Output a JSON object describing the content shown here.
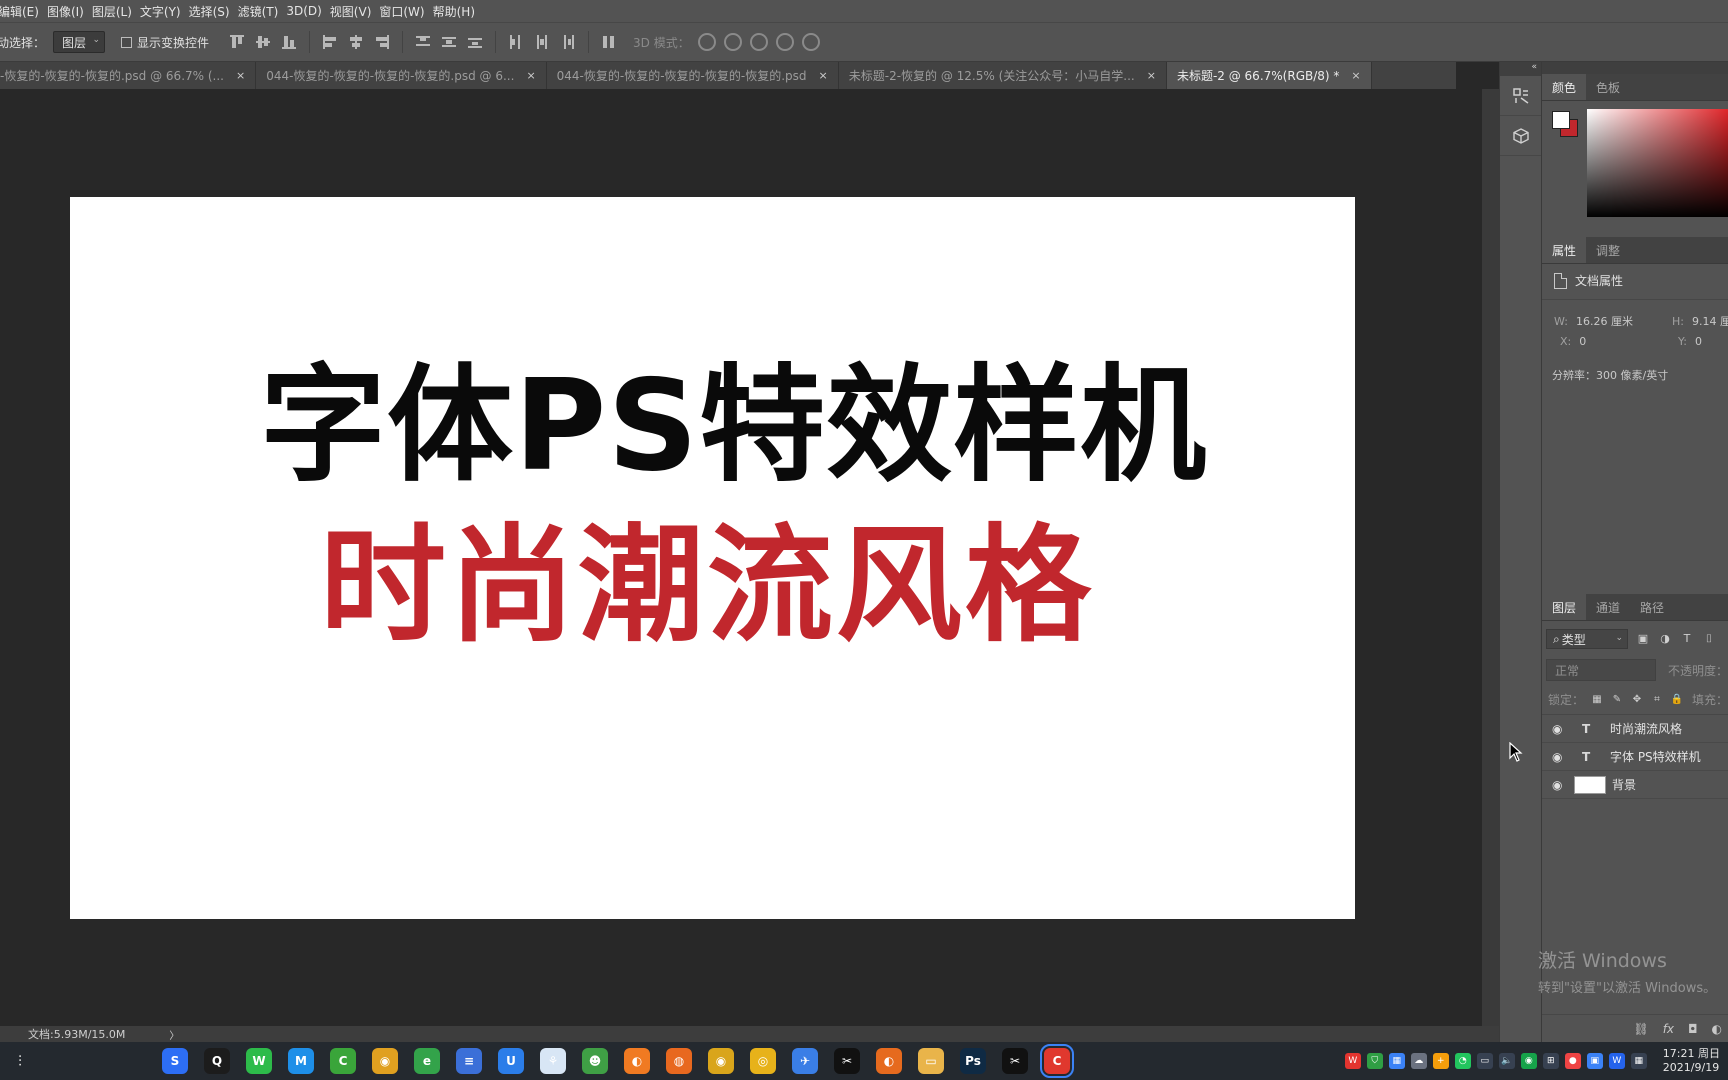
{
  "menu": [
    "编辑(E)",
    "图像(I)",
    "图层(L)",
    "文字(Y)",
    "选择(S)",
    "滤镜(T)",
    "3D(D)",
    "视图(V)",
    "窗口(W)",
    "帮助(H)"
  ],
  "options": {
    "auto_select_label": "动选择：",
    "auto_select_value": "图层",
    "show_transform_label": "显示变换控件",
    "mode_3d_label": "3D 模式："
  },
  "tabs": [
    {
      "label": "-恢复的-恢复的-恢复的.psd @ 66.7% (...",
      "active": false
    },
    {
      "label": "044-恢复的-恢复的-恢复的-恢复的.psd @ 6...",
      "active": false
    },
    {
      "label": "044-恢复的-恢复的-恢复的-恢复的-恢复的.psd",
      "active": false
    },
    {
      "label": "未标题-2-恢复的 @ 12.5% (关注公众号：小马自学...",
      "active": false
    },
    {
      "label": "未标题-2 @ 66.7%(RGB/8) *",
      "active": true
    }
  ],
  "tab_close_glyph": "×",
  "canvas": {
    "line1": "字体PS特效样机",
    "line2": "时尚潮流风格",
    "line1_color": "#0a0a0a",
    "line2_color": "#c1272d"
  },
  "status": {
    "doc_size": "文档:5.93M/15.0M",
    "arrow": "〉"
  },
  "color_panel": {
    "tabs": [
      "颜色",
      "色板"
    ],
    "fg_color": "#ffffff",
    "bg_color": "#c1272d"
  },
  "properties_panel": {
    "tabs": [
      "属性",
      "调整"
    ],
    "header": "文档属性",
    "w_label": "W:",
    "w_value": "16.26 厘米",
    "h_label": "H:",
    "h_value": "9.14 厘",
    "x_label": "X:",
    "x_value": "0",
    "y_label": "Y:",
    "y_value": "0",
    "resolution": "分辨率：300 像素/英寸"
  },
  "layers_panel": {
    "tabs": [
      "图层",
      "通道",
      "路径"
    ],
    "filter_value": "类型",
    "blend_mode": "正常",
    "opacity_label": "不透明度：",
    "lock_label": "锁定：",
    "fill_label": "填充：",
    "layers": [
      {
        "name": "时尚潮流风格",
        "kind": "text",
        "type_glyph": "T"
      },
      {
        "name": "字体 PS特效样机",
        "kind": "text",
        "type_glyph": "T"
      },
      {
        "name": "背景",
        "kind": "background",
        "type_glyph": ""
      }
    ],
    "bottom_icons": [
      "link-icon",
      "fx-icon",
      "mask-icon",
      "adjustment-icon"
    ],
    "bottom_fx": "fx"
  },
  "watermark": {
    "line1": "激活 Windows",
    "line2": "转到\"设置\"以激活 Windows。"
  },
  "taskbar": {
    "apps": [
      {
        "name": "sogou-icon",
        "color": "#2d6ef5",
        "glyph": "S"
      },
      {
        "name": "qq-icon",
        "color": "#1c1c1c",
        "glyph": "Q"
      },
      {
        "name": "wechat-icon",
        "color": "#2dbb4a",
        "glyph": "W"
      },
      {
        "name": "meeting-icon",
        "color": "#1e8fe8",
        "glyph": "M"
      },
      {
        "name": "camtasia-icon",
        "color": "#3aa53a",
        "glyph": "C"
      },
      {
        "name": "chrome-icon",
        "color": "#e0a020",
        "glyph": "◉"
      },
      {
        "name": "browser-green-icon",
        "color": "#33a34a",
        "glyph": "e"
      },
      {
        "name": "notes-icon",
        "color": "#3b6fd8",
        "glyph": "≡"
      },
      {
        "name": "baidu-disk-icon",
        "color": "#2b7de9",
        "glyph": "U"
      },
      {
        "name": "photos-icon",
        "color": "#d8e6f5",
        "glyph": "⚘"
      },
      {
        "name": "game-icon",
        "color": "#3f9f45",
        "glyph": "☻"
      },
      {
        "name": "orange-app-icon",
        "color": "#f07a22",
        "glyph": "◐"
      },
      {
        "name": "firefox-icon",
        "color": "#e8681f",
        "glyph": "◍"
      },
      {
        "name": "chrome2-icon",
        "color": "#d9a51b",
        "glyph": "◉"
      },
      {
        "name": "yellow-app-icon",
        "color": "#e7b21a",
        "glyph": "◎"
      },
      {
        "name": "feishu-icon",
        "color": "#3a7ee6",
        "glyph": "✈"
      },
      {
        "name": "capcut-icon",
        "color": "#111111",
        "glyph": "✂"
      },
      {
        "name": "orange2-app-icon",
        "color": "#e66a1e",
        "glyph": "◐"
      },
      {
        "name": "folder-icon",
        "color": "#e9b44a",
        "glyph": "▭"
      },
      {
        "name": "photoshop-icon",
        "color": "#0f2a44",
        "glyph": "Ps"
      },
      {
        "name": "capcut2-icon",
        "color": "#111111",
        "glyph": "✂"
      },
      {
        "name": "red-app-icon",
        "color": "#e0382e",
        "glyph": "C"
      }
    ],
    "active_app": "red-app-icon",
    "clock_time": "17:21 周日",
    "clock_date": "2021/9/19"
  }
}
